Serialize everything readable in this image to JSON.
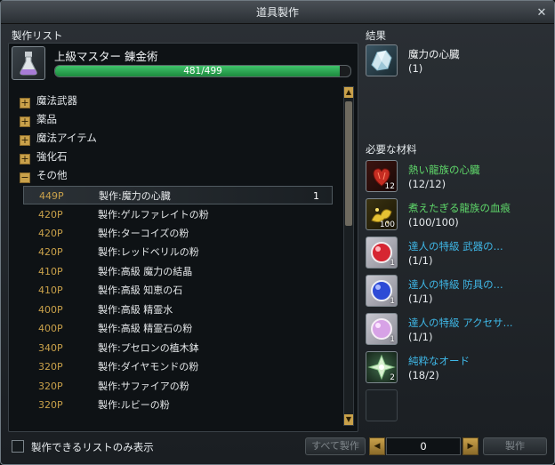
{
  "window": {
    "title": "道具製作",
    "close_glyph": "✕"
  },
  "left": {
    "section_label": "製作リスト",
    "rank_title": "上級マスター  錬金術",
    "exp_text": "481/499",
    "exp_fraction": 0.964
  },
  "categories": [
    {
      "label": "魔法武器",
      "glyph": "+"
    },
    {
      "label": "薬品",
      "glyph": "+"
    },
    {
      "label": "魔法アイテム",
      "glyph": "+"
    },
    {
      "label": "強化石",
      "glyph": "+"
    },
    {
      "label": "その他",
      "glyph": "−"
    }
  ],
  "recipes": [
    {
      "points": "449P",
      "name": "製作:魔力の心臓",
      "qty": "1"
    },
    {
      "points": "420P",
      "name": "製作:ゲルファレイトの粉",
      "qty": ""
    },
    {
      "points": "420P",
      "name": "製作:ターコイズの粉",
      "qty": ""
    },
    {
      "points": "420P",
      "name": "製作:レッドベリルの粉",
      "qty": ""
    },
    {
      "points": "410P",
      "name": "製作:高級 魔力の結晶",
      "qty": ""
    },
    {
      "points": "410P",
      "name": "製作:高級 知恵の石",
      "qty": ""
    },
    {
      "points": "400P",
      "name": "製作:高級 精霊水",
      "qty": ""
    },
    {
      "points": "400P",
      "name": "製作:高級 精霊石の粉",
      "qty": ""
    },
    {
      "points": "340P",
      "name": "製作:プセロンの植木鉢",
      "qty": ""
    },
    {
      "points": "320P",
      "name": "製作:ダイヤモンドの粉",
      "qty": ""
    },
    {
      "points": "320P",
      "name": "製作:サファイアの粉",
      "qty": ""
    },
    {
      "points": "320P",
      "name": "製作:ルビーの粉",
      "qty": ""
    }
  ],
  "result": {
    "section_label": "結果",
    "name": "魔力の心臓",
    "count": "(1)",
    "name_color": "#f2f4f5"
  },
  "materials": {
    "section_label": "必要な材料",
    "items": [
      {
        "name": "熱い龍族の心臓",
        "count": "(12/12)",
        "badge": "12",
        "color": "#5fd86a",
        "icon": "dragon-heart-icon"
      },
      {
        "name": "煮えたぎる龍族の血痕",
        "count": "(100/100)",
        "badge": "100",
        "color": "#5fd86a",
        "icon": "dragon-blood-icon"
      },
      {
        "name": "達人の特級  武器の...",
        "count": "(1/1)",
        "badge": "1",
        "color": "#3fb8e8",
        "icon": "red-orb-icon"
      },
      {
        "name": "達人の特級  防具の...",
        "count": "(1/1)",
        "badge": "1",
        "color": "#3fb8e8",
        "icon": "blue-orb-icon"
      },
      {
        "name": "達人の特級  アクセサ...",
        "count": "(1/1)",
        "badge": "1",
        "color": "#3fb8e8",
        "icon": "pink-orb-icon"
      },
      {
        "name": "純粋なオード",
        "count": "(18/2)",
        "badge": "2",
        "color": "#3fb8e8",
        "icon": "ode-crystal-icon"
      }
    ]
  },
  "footer": {
    "checkbox_label": "製作できるリストのみ表示",
    "craft_all_label": "すべて製作",
    "quantity": "0",
    "craft_label": "製作"
  }
}
